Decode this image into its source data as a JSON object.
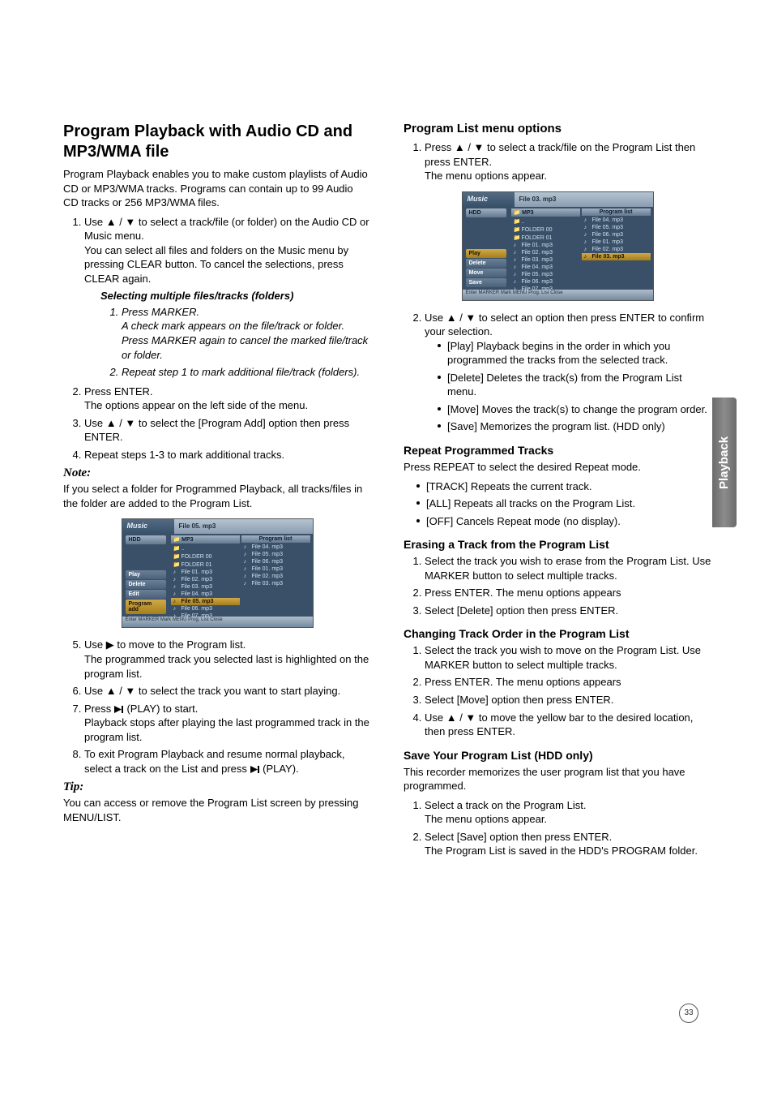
{
  "page_number": "33",
  "side_tab": "Playback",
  "left": {
    "h1": "Program Playback with Audio CD and MP3/WMA file",
    "intro": "Program Playback enables you to make custom playlists of Audio CD or MP3/WMA tracks. Programs can contain up to 99 Audio CD tracks or 256 MP3/WMA files.",
    "step1": "Use ▲ / ▼ to select a track/file (or folder) on the Audio CD or Music menu.\nYou can select all files and folders on the Music menu by pressing CLEAR button. To cancel the selections, press CLEAR again.",
    "subhead": "Selecting multiple files/tracks (folders)",
    "sub1": "Press MARKER.\nA check mark appears on the file/track or folder. Press MARKER again to cancel the marked file/track or folder.",
    "sub2": "Repeat step 1 to mark additional file/track (folders).",
    "step2": "Press ENTER.\nThe options appear on the left side of the menu.",
    "step3": "Use ▲ / ▼ to select the [Program Add] option then press ENTER.",
    "step4": "Repeat steps 1-3 to mark additional tracks.",
    "note_label": "Note:",
    "note_text": "If you select a folder for Programmed Playback, all tracks/files in the folder are added to the Program List.",
    "step5": "Use ▶ to move to the Program list.\nThe programmed track you selected last is highlighted on the program list.",
    "step6": "Use ▲ / ▼ to select the track you want to start playing.",
    "step7_a": "Press ",
    "step7_b": " (PLAY) to start.\nPlayback stops after playing the last programmed track in the program list.",
    "step8_a": "To exit Program Playback and resume normal playback, select a track on the List and press ",
    "step8_b": " (PLAY).",
    "tip_label": "Tip:",
    "tip_text": "You can access or remove the Program List screen by pressing MENU/LIST.",
    "ss": {
      "title": "Music",
      "file": "File 05. mp3",
      "tab": "HDD",
      "left_header": "MP3",
      "right_header": "Program list",
      "menu": [
        "Play",
        "Delete",
        "Edit",
        "Program add"
      ],
      "menu_sel": 3,
      "left_rows": [
        "..",
        "FOLDER 00",
        "FOLDER 01",
        "File 01. mp3",
        "File 02. mp3",
        "File 03. mp3",
        "File 04. mp3",
        "File 05. mp3",
        "File 06. mp3",
        "File 07. mp3"
      ],
      "left_hl": 7,
      "right_rows": [
        "File 04. mp3",
        "File 05. mp3",
        "File 06. mp3",
        "File 01. mp3",
        "File 02. mp3",
        "File 03. mp3"
      ],
      "right_hl": -1,
      "footer": "Enter   MARKER Mark   MENU Prog. List        Close"
    }
  },
  "right": {
    "h2": "Program List menu options",
    "step1": "Press ▲ / ▼ to select a track/file on the Program List then press ENTER.\nThe menu options appear.",
    "ss": {
      "title": "Music",
      "file": "File 03. mp3",
      "tab": "HDD",
      "left_header": "MP3",
      "right_header": "Program list",
      "menu": [
        "Play",
        "Delete",
        "Move",
        "Save"
      ],
      "menu_sel": 0,
      "left_rows": [
        "..",
        "FOLDER 00",
        "FOLDER 01",
        "File 01. mp3",
        "File 02. mp3",
        "File 03. mp3",
        "File 04. mp3",
        "File 05. mp3",
        "File 06. mp3",
        "File 07. mp3"
      ],
      "left_hl": -1,
      "right_rows": [
        "File 04. mp3",
        "File 05. mp3",
        "File 06. mp3",
        "File 01. mp3",
        "File 02. mp3",
        "File 03. mp3"
      ],
      "right_hl": 5,
      "footer": "Enter   MARKER Mark   MENU Prog. List        Close"
    },
    "step2": "Use ▲ / ▼ to select an option then press ENTER to confirm your selection.",
    "opt_play": "[Play] Playback begins in the order in which you programmed the tracks from the selected track.",
    "opt_delete": "[Delete] Deletes the track(s) from the Program List menu.",
    "opt_move": "[Move] Moves the track(s) to change the program order.",
    "opt_save": "[Save] Memorizes the program list. (HDD only)",
    "repeat_h": "Repeat Programmed Tracks",
    "repeat_p": "Press REPEAT to select the desired Repeat mode.",
    "repeat_track": "[TRACK] Repeats the current track.",
    "repeat_all": "[ALL] Repeats all tracks on the Program List.",
    "repeat_off": "[OFF] Cancels Repeat mode (no display).",
    "erase_h": "Erasing a Track from the Program List",
    "erase1": "Select the track you wish to erase from the Program List. Use MARKER button to select multiple tracks.",
    "erase2": "Press ENTER. The menu options appears",
    "erase3": "Select [Delete] option then press ENTER.",
    "order_h": "Changing Track Order in the Program List",
    "order1": "Select the track you wish to move on the Program List. Use MARKER button to select multiple tracks.",
    "order2": "Press ENTER. The menu options appears",
    "order3": "Select [Move] option then press ENTER.",
    "order4": "Use ▲ / ▼ to move the yellow bar to the desired location, then press ENTER.",
    "save_h": "Save Your Program List (HDD only)",
    "save_p": "This recorder memorizes the user program list that you have programmed.",
    "save1": "Select a track on the Program List.\nThe menu options appear.",
    "save2": "Select [Save] option then press ENTER.\nThe Program List is saved in the HDD's PROGRAM folder."
  }
}
